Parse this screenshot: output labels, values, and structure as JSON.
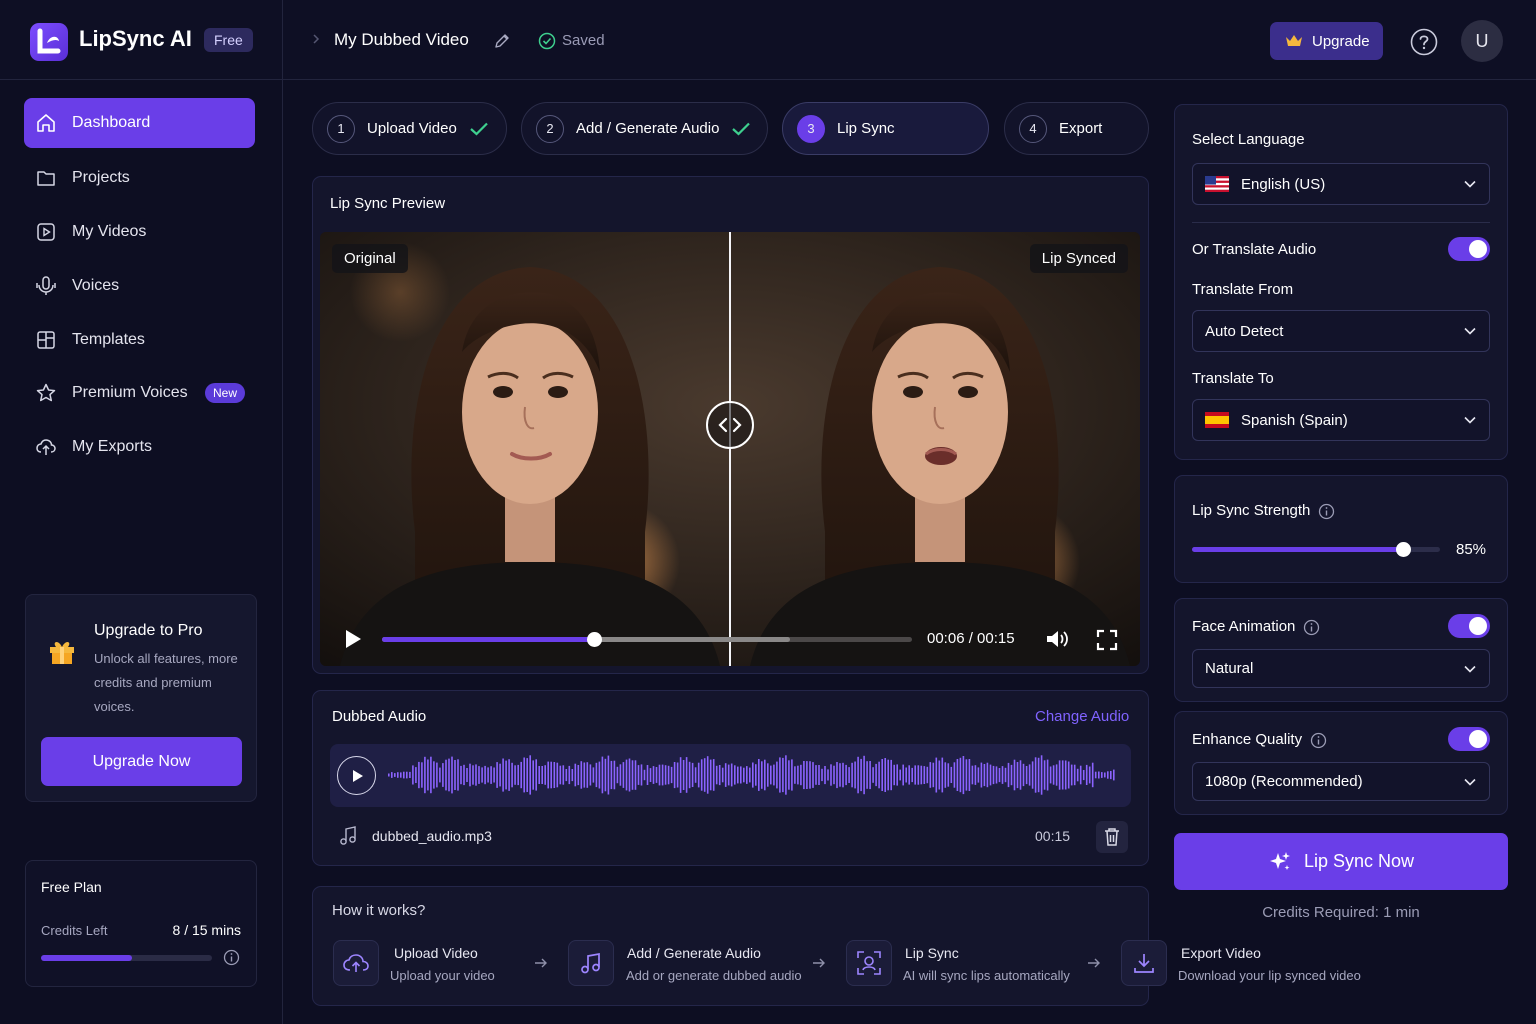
{
  "app": {
    "name": "LipSync AI",
    "plan_badge": "Free"
  },
  "header": {
    "title": "My Dubbed Video",
    "status": "Saved",
    "upgrade_label": "Upgrade",
    "avatar_initial": "U"
  },
  "sidebar": {
    "items": [
      {
        "label": "Dashboard",
        "icon": "home-icon",
        "active": true
      },
      {
        "label": "Projects",
        "icon": "folder-icon"
      },
      {
        "label": "My Videos",
        "icon": "video-icon"
      },
      {
        "label": "Voices",
        "icon": "voice-icon"
      },
      {
        "label": "Templates",
        "icon": "templates-icon"
      },
      {
        "label": "Premium Voices",
        "icon": "star-icon",
        "badge": "New"
      },
      {
        "label": "My Exports",
        "icon": "export-icon"
      }
    ],
    "promo": {
      "title": "Upgrade to Pro",
      "text": "Unlock all features, more credits and premium voices.",
      "button": "Upgrade Now"
    },
    "plan": {
      "title": "Free Plan",
      "credits_label": "Credits Left",
      "credits_value": "8 / 15 mins",
      "credits_used_fraction": 0.53
    }
  },
  "steps": [
    {
      "num": "1",
      "label": "Upload Video",
      "done": true
    },
    {
      "num": "2",
      "label": "Add / Generate Audio",
      "done": true
    },
    {
      "num": "3",
      "label": "Lip Sync",
      "active": true
    },
    {
      "num": "4",
      "label": "Export"
    }
  ],
  "preview": {
    "title": "Lip Sync Preview",
    "left_label": "Original",
    "right_label": "Lip Synced",
    "time": "00:06 / 00:15",
    "progress_fraction": 0.4,
    "buffered_fraction": 0.77
  },
  "audio": {
    "title": "Dubbed Audio",
    "change_label": "Change Audio",
    "file_name": "dubbed_audio.mp3",
    "duration": "00:15"
  },
  "language": {
    "select_label": "Select Language",
    "language": "English (US)",
    "translate_label": "Or Translate Audio",
    "translate_enabled": true,
    "from_label": "Translate From",
    "from_value": "Auto Detect",
    "to_label": "Translate To",
    "to_value": "Spanish (Spain)"
  },
  "strength": {
    "label": "Lip Sync Strength",
    "value": 85,
    "value_text": "85%"
  },
  "face": {
    "label": "Face Animation",
    "enabled": true,
    "value": "Natural"
  },
  "quality": {
    "label": "Enhance Quality",
    "enabled": true,
    "value": "1080p (Recommended)"
  },
  "action": {
    "label": "Lip Sync Now",
    "credits_note": "Credits Required: 1 min"
  },
  "how": {
    "title": "How it works?",
    "steps": [
      {
        "title": "Upload Video",
        "sub": "Upload your video",
        "icon": "upload-cloud-icon"
      },
      {
        "title": "Add / Generate Audio",
        "sub": "Add or generate dubbed audio",
        "icon": "music-icon"
      },
      {
        "title": "Lip Sync",
        "sub": "AI will sync lips automatically",
        "icon": "face-scan-icon"
      },
      {
        "title": "Export Video",
        "sub": "Download your lip synced video",
        "icon": "download-icon"
      }
    ]
  },
  "colors": {
    "accent": "#6a3ee8",
    "background": "#0d0e22",
    "panel": "#14152c"
  }
}
